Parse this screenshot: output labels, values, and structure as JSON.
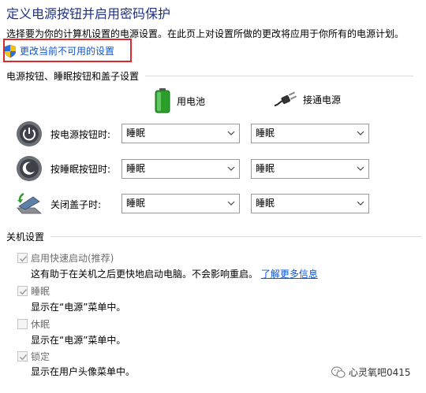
{
  "header": {
    "title": "定义电源按钮并启用密码保护",
    "description": "选择要为你的计算机设置的电源设置。在此页上对设置所做的更改将应用于你所有的电源计划。",
    "change_link": "更改当前不可用的设置"
  },
  "power_section": {
    "title": "电源按钮、睡眠按钮和盖子设置",
    "columns": {
      "battery": "用电池",
      "plugged_in": "接通电源"
    },
    "rows": [
      {
        "label": "按电源按钮时:",
        "battery": "睡眠",
        "plugged_in": "睡眠"
      },
      {
        "label": "按睡眠按钮时:",
        "battery": "睡眠",
        "plugged_in": "睡眠"
      },
      {
        "label": "关闭盖子时:",
        "battery": "睡眠",
        "plugged_in": "睡眠"
      }
    ]
  },
  "shutdown_section": {
    "title": "关机设置",
    "options": [
      {
        "label": "启用快速启动(推荐)",
        "checked": true,
        "desc": "这有助于在关机之后更快地启动电脑。不会影响重启。",
        "link": "了解更多信息"
      },
      {
        "label": "睡眠",
        "checked": true,
        "desc": "显示在“电源”菜单中。"
      },
      {
        "label": "休眠",
        "checked": false,
        "desc": "显示在“电源”菜单中。"
      },
      {
        "label": "锁定",
        "checked": true,
        "desc": "显示在用户头像菜单中。"
      }
    ]
  },
  "watermark": "心灵氧吧0415",
  "colors": {
    "title": "#1e3287",
    "link": "#0b56d6",
    "highlight": "#d92b2b"
  }
}
